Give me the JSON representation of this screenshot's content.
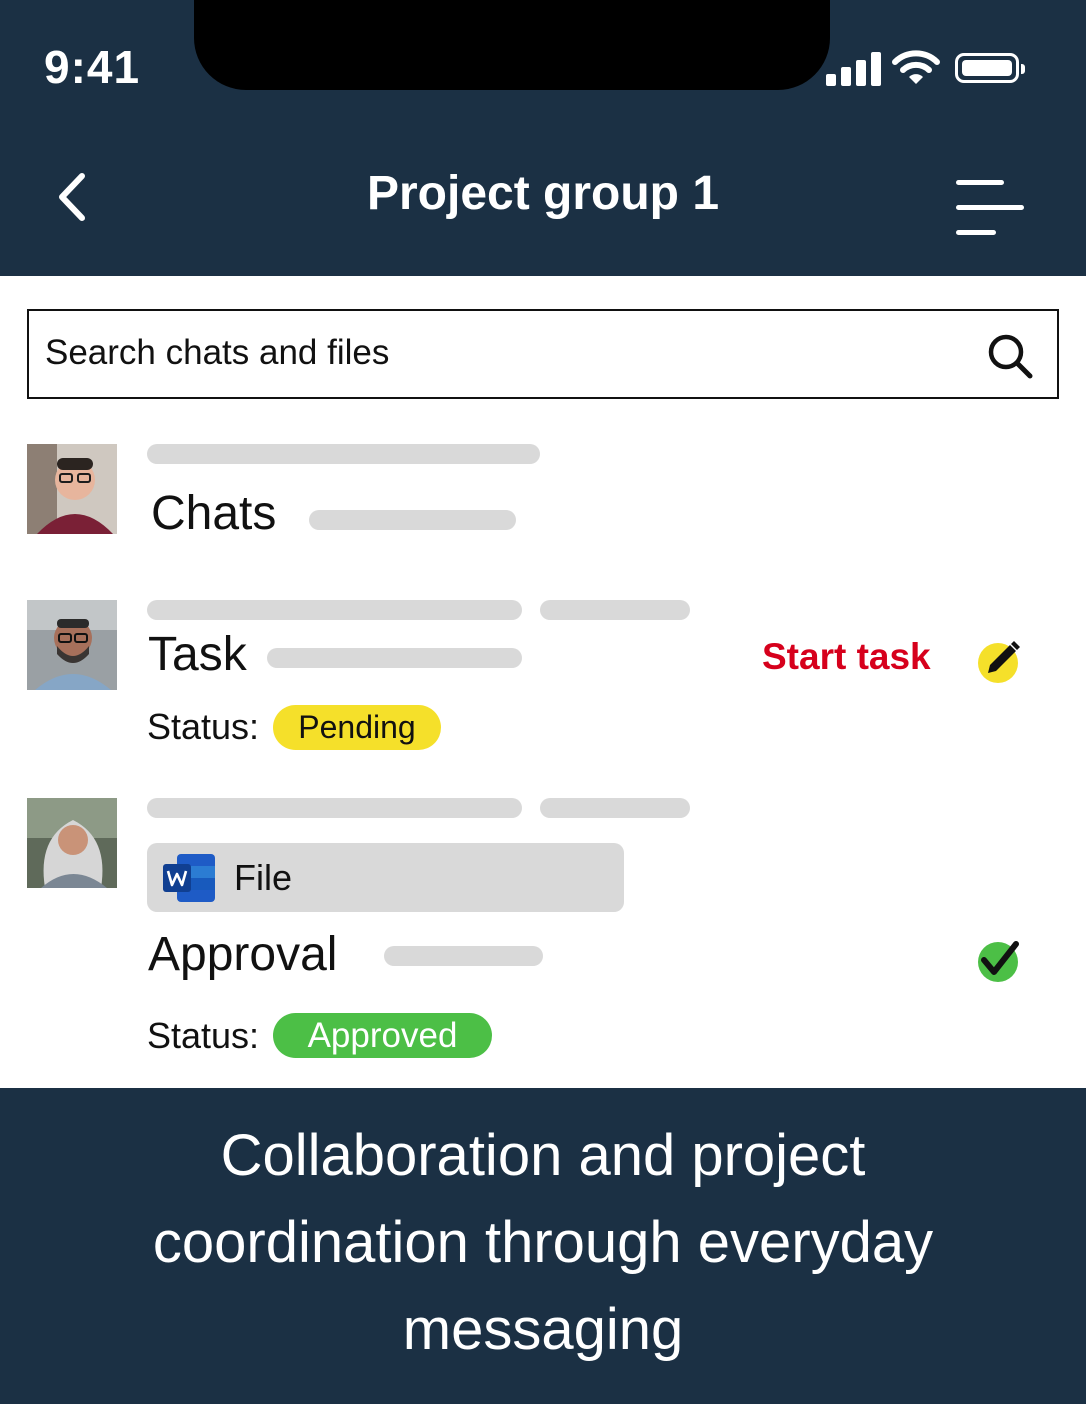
{
  "status_bar": {
    "time": "9:41"
  },
  "header": {
    "title": "Project group 1"
  },
  "search": {
    "placeholder": "Search chats and files"
  },
  "items": [
    {
      "label": "Chats"
    },
    {
      "label": "Task",
      "action": "Start task",
      "status_label": "Status:",
      "status": "Pending",
      "status_color": "#f5e02a"
    },
    {
      "file_label": "File",
      "label": "Approval",
      "status_label": "Status:",
      "status": "Approved",
      "status_color": "#4cbf46"
    }
  ],
  "footer": {
    "text": "Collaboration and project coordination through everyday messaging"
  },
  "colors": {
    "header_bg": "#1b3044",
    "accent_red": "#d6001c",
    "placeholder": "#d9d9d9"
  }
}
